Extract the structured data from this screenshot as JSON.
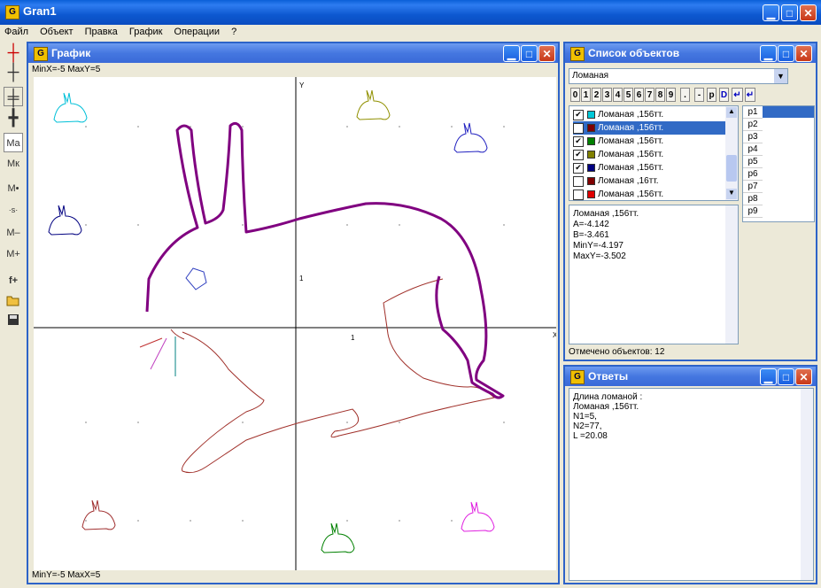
{
  "app": {
    "title": "Gran1",
    "icon": "G"
  },
  "menu": [
    "Файл",
    "Объект",
    "Правка",
    "График",
    "Операции",
    "?"
  ],
  "toolbar_icons": [
    "axes-red-icon",
    "axes-icon",
    "axes-grid-icon",
    "axes-ticks-icon",
    "mark-a-icon",
    "mark-k-icon",
    "m-point-icon",
    "scale-icon",
    "m-minus-icon",
    "m-plus-icon",
    "f-plus-icon",
    "open-folder-icon",
    "save-disk-icon"
  ],
  "toolbar_labels": {
    "ma": "Ma",
    "mk": "Mк",
    "mpt": "M•",
    "mminus": "M–",
    "mplus": "M+",
    "fplus": "f+"
  },
  "graph": {
    "title": "График",
    "top_status": "MinX=-5  MaxY=5",
    "bottom_status": "MinY=-5  MaxX=5",
    "axis_x": "X",
    "axis_y": "Y",
    "tick_x": "1",
    "tick_y": "1"
  },
  "objects": {
    "title": "Список объектов",
    "combo_value": "Ломаная",
    "buttons": [
      "0",
      "1",
      "2",
      "3",
      "4",
      "5",
      "6",
      "7",
      "8",
      "9",
      ".",
      "-",
      "p",
      "D",
      "↵",
      "↵"
    ],
    "rows": [
      {
        "label": "Ломаная ,156тт.",
        "checked": true,
        "color": "#00c8d8",
        "selected": false
      },
      {
        "label": "Ломаная ,156тт.",
        "checked": true,
        "color": "#800000",
        "selected": true
      },
      {
        "label": "Ломаная ,156тт.",
        "checked": true,
        "color": "#008000",
        "selected": false
      },
      {
        "label": "Ломаная ,156тт.",
        "checked": true,
        "color": "#808000",
        "selected": false
      },
      {
        "label": "Ломаная ,156тт.",
        "checked": true,
        "color": "#000080",
        "selected": false
      },
      {
        "label": "Ломаная ,16тт.",
        "checked": false,
        "color": "#800000",
        "selected": false
      },
      {
        "label": "Ломаная ,156тт.",
        "checked": false,
        "color": "#e00000",
        "selected": false
      }
    ],
    "params": [
      "p1",
      "p2",
      "p3",
      "p4",
      "p5",
      "p6",
      "p7",
      "p8",
      "p9"
    ],
    "info": [
      "Ломаная ,156тт.",
      "A=-4.142",
      "B=-3.461",
      "MinY=-4.197",
      "MaxY=-3.502"
    ],
    "status_label": "Отмечено объектов:",
    "status_count": "12"
  },
  "answers": {
    "title": "Ответы",
    "lines": [
      "Длина ломаной  :",
      "Ломаная ,156тт.",
      "N1=5,",
      "N2=77,",
      "L =20.08"
    ]
  }
}
